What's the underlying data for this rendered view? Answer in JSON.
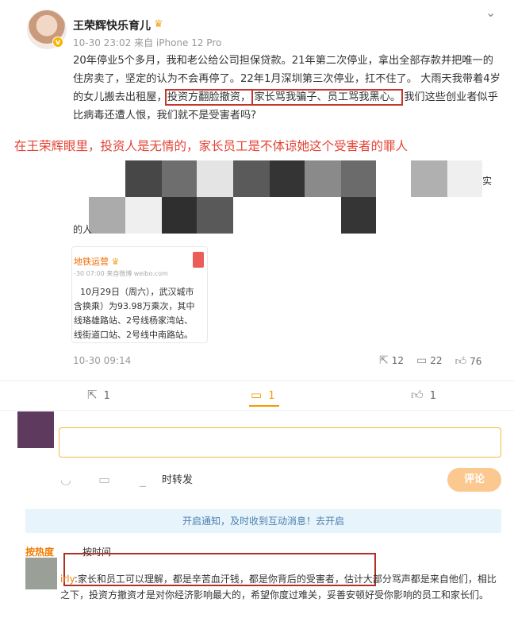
{
  "post": {
    "username": "王荣辉快乐育儿",
    "meta": "10-30 23:02 来自 iPhone 12 Pro",
    "text_before": "20年停业5个多月，我和老公给公司担保贷款。21年第二次停业，拿出全部存款并把唯一的住房卖了，坚定的认为不会再停了。22年1月深圳第三次停业，扛不住了。 大雨天我带着4岁的女儿搬去出租屋，",
    "highlight1": "投资方翻脸撤资，",
    "highlight2": "家长骂我骗子、员工骂我黑心。",
    "text_after": "我们这些创业者似乎比病毒还遭人恨，我们就不是受害者吗?"
  },
  "annotation": "在王荣辉眼里，投资人是无情的，家长员工是不体谅她这个受害者的罪人",
  "mosaic_fragments": [
    "实",
    "的人"
  ],
  "quote_card": {
    "name": "地铁运营",
    "meta": "-30 07:00  来自微博 weibo.com",
    "lines": [
      "10月29日（周六），武汉城市",
      "含换乘）为93.98万乘次，其中",
      "线珞雄路站、2号线杨家湾站、",
      "线街道口站、2号线中南路站。"
    ]
  },
  "inner": {
    "time": "10-30 09:14",
    "reposts": "12",
    "comments": "22",
    "likes": "76"
  },
  "actions": {
    "repost": "1",
    "comment": "1",
    "like": "1"
  },
  "composer": {
    "repost_label": "时转发",
    "submit": "评论"
  },
  "notice": "开启通知，及时收到互动消息！去开启",
  "sort": {
    "hot": "按热度",
    "time": "按时间"
  },
  "comment": {
    "user": "irly",
    "text": ":家长和员工可以理解，都是辛苦血汗钱，都是你背后的受害者，估计大部分骂声都是来自他们，相比之下，投资方撤资才是对你经济影响最大的，希望你度过难关，妥善安顿好受你影响的员工和家长们。"
  },
  "colors": {
    "accent": "#f59b00",
    "highlight_box": "#c0392b",
    "annotation": "#e34234"
  }
}
